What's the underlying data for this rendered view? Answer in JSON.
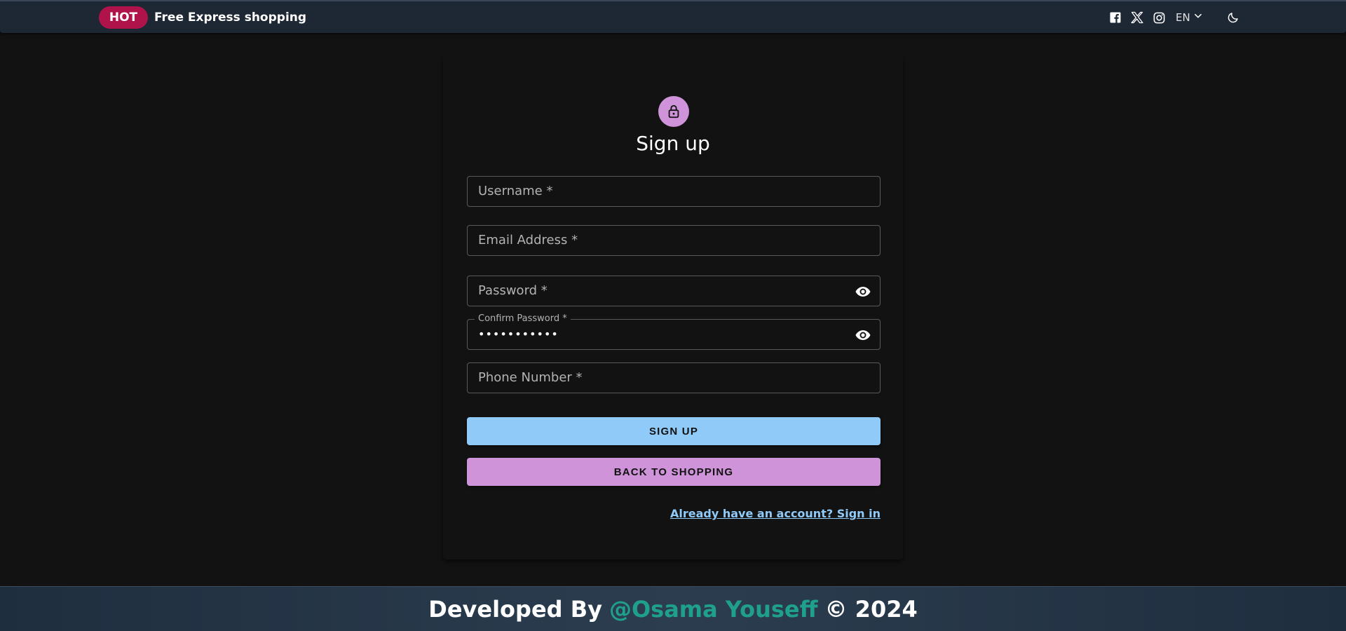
{
  "topbar": {
    "badge": "HOT",
    "promo": "Free Express shopping",
    "icons": [
      "facebook-icon",
      "x-icon",
      "instagram-icon"
    ],
    "language": "EN",
    "theme_toggle_icon": "moon-icon"
  },
  "form": {
    "title": "Sign up",
    "avatar_icon": "lock-icon",
    "fields": {
      "username": {
        "label": "Username *"
      },
      "email": {
        "label": "Email Address *"
      },
      "password": {
        "label": "Password *"
      },
      "confirm_password": {
        "label": "Confirm Password *",
        "value": "•••••••••••"
      },
      "phone": {
        "label": "Phone Number *"
      }
    },
    "signup_button": "SIGN UP",
    "back_button": "BACK TO SHOPPING",
    "signin_link": "Already have an account? Sign in"
  },
  "footer": {
    "prefix": "Developed By",
    "author": "@Osama Youseff",
    "suffix": "© 2024"
  },
  "colors": {
    "background": "#121212",
    "topbar": "#1e2734",
    "hot_badge": "#b0134a",
    "primary": "#90caf9",
    "secondary": "#ce93d8",
    "footer_author": "#1fa08c"
  }
}
